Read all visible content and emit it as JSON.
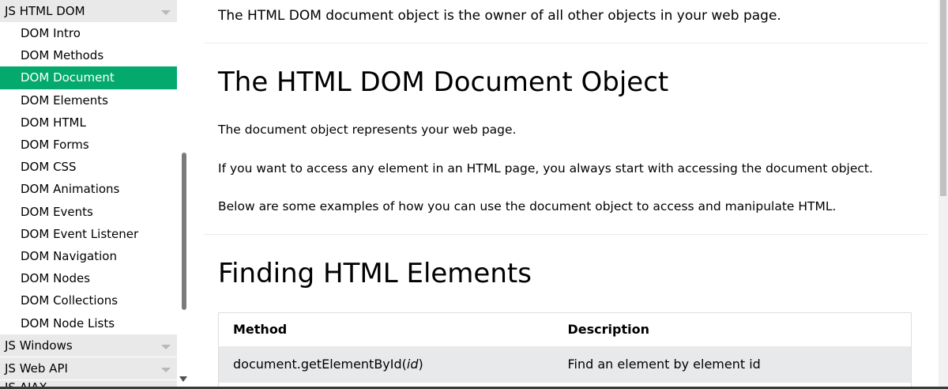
{
  "sidebar": {
    "header": "JS HTML DOM",
    "items": [
      {
        "label": "DOM Intro"
      },
      {
        "label": "DOM Methods"
      },
      {
        "label": "DOM Document",
        "active": true
      },
      {
        "label": "DOM Elements"
      },
      {
        "label": "DOM HTML"
      },
      {
        "label": "DOM Forms"
      },
      {
        "label": "DOM CSS"
      },
      {
        "label": "DOM Animations"
      },
      {
        "label": "DOM Events"
      },
      {
        "label": "DOM Event Listener"
      },
      {
        "label": "DOM Navigation"
      },
      {
        "label": "DOM Nodes"
      },
      {
        "label": "DOM Collections"
      },
      {
        "label": "DOM Node Lists"
      }
    ],
    "sections": [
      "JS Windows",
      "JS Web API",
      "JS AJAX"
    ]
  },
  "main": {
    "intro": "The HTML DOM document object is the owner of all other objects in your web page.",
    "heading1": "The HTML DOM Document Object",
    "p1": "The document object represents your web page.",
    "p2": "If you want to access any element in an HTML page, you always start with accessing the document object.",
    "p3": "Below are some examples of how you can use the document object to access and manipulate HTML.",
    "heading2": "Finding HTML Elements",
    "table": {
      "headers": [
        "Method",
        "Description"
      ],
      "rows": [
        {
          "method": "document.getElementById(",
          "arg": "id",
          "method_end": ")",
          "description": "Find an element by element id"
        }
      ]
    }
  },
  "colors": {
    "accent": "#04aa6d",
    "section_bg": "#e9e9e9",
    "row_bg": "#e7e9eb"
  },
  "icons": [
    "dropdown-triangle-icon",
    "scroll-down-arrow-icon"
  ]
}
